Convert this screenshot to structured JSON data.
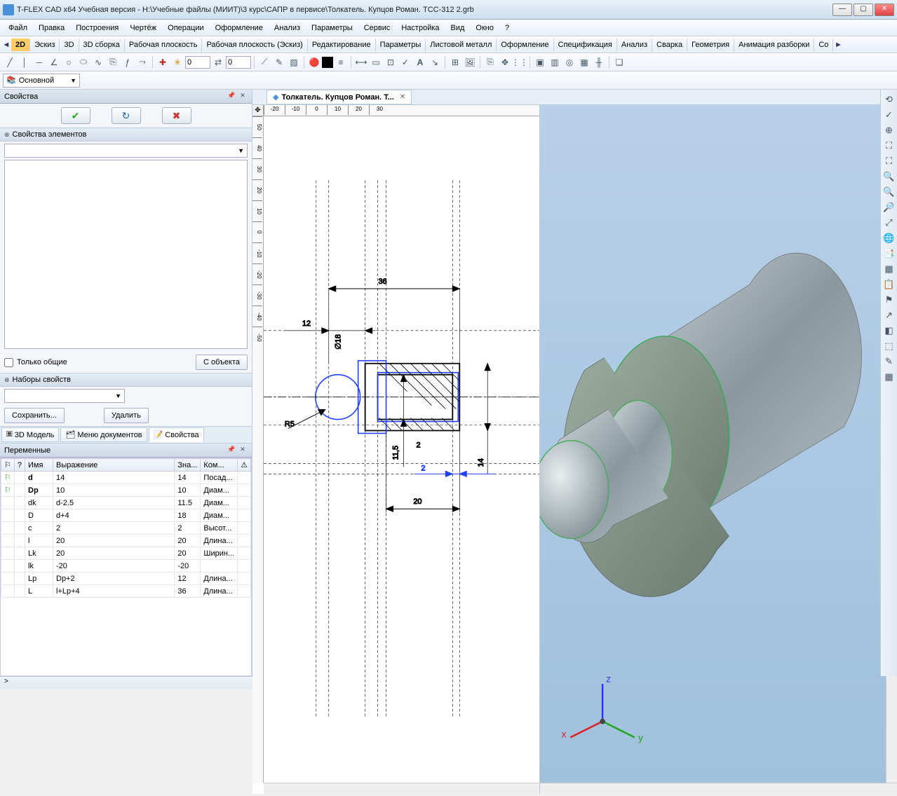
{
  "title": "T-FLEX CAD x64 Учебная версия - H:\\Учебные файлы (МИИТ)\\3 курс\\САПР в первисе\\Толкатель. Купцов Роман. ТСС-312 2.grb",
  "menu": [
    "Файл",
    "Правка",
    "Построения",
    "Чертёж",
    "Операции",
    "Оформление",
    "Анализ",
    "Параметры",
    "Сервис",
    "Настройка",
    "Вид",
    "Окно",
    "?"
  ],
  "modetabs": [
    "2D",
    "Эскиз",
    "3D",
    "3D сборка",
    "Рабочая плоскость",
    "Рабочая плоскость (Эскиз)",
    "Редактирование",
    "Параметры",
    "Листовой металл",
    "Оформление",
    "Спецификация",
    "Анализ",
    "Сварка",
    "Геометрия",
    "Анимация разборки",
    "Со"
  ],
  "active_modetab": "2D",
  "layer_label": "Основной",
  "num1": "0",
  "num2": "0",
  "properties": {
    "title": "Свойства",
    "section1": "Свойства элементов",
    "only_common": "Только общие",
    "from_object": "С объекта",
    "section2": "Наборы свойств",
    "save_btn": "Сохранить...",
    "delete_btn": "Удалить"
  },
  "bottom_tabs": {
    "m3d": "3D Модель",
    "docmenu": "Меню документов",
    "props": "Свойства"
  },
  "vars": {
    "title": "Переменные",
    "cols": {
      "q": "?",
      "name": "Имя",
      "expr": "Выражение",
      "val": "Зна...",
      "com": "Ком..."
    },
    "rows": [
      {
        "flag": 1,
        "name": "d",
        "expr": "14",
        "val": "14",
        "com": "Посад...",
        "bold": true
      },
      {
        "flag": 1,
        "name": "Dp",
        "expr": "10",
        "val": "10",
        "com": "Диам...",
        "bold": true
      },
      {
        "flag": 0,
        "name": "dk",
        "expr": "d-2.5",
        "val": "11.5",
        "com": "Диам..."
      },
      {
        "flag": 0,
        "name": "D",
        "expr": "d+4",
        "val": "18",
        "com": "Диам..."
      },
      {
        "flag": 0,
        "name": "c",
        "expr": "2",
        "val": "2",
        "com": "Высот..."
      },
      {
        "flag": 0,
        "name": "l",
        "expr": "20",
        "val": "20",
        "com": "Длина..."
      },
      {
        "flag": 0,
        "name": "Lk",
        "expr": "20",
        "val": "20",
        "com": "Ширин..."
      },
      {
        "flag": 0,
        "name": "lk",
        "expr": "-20",
        "val": "-20",
        "com": ""
      },
      {
        "flag": 0,
        "name": "Lp",
        "expr": "Dp+2",
        "val": "12",
        "com": "Длина..."
      },
      {
        "flag": 0,
        "name": "L",
        "expr": "l+Lp+4",
        "val": "36",
        "com": "Длина..."
      }
    ]
  },
  "doc_tab": "Толкатель. Купцов Роман. Т...",
  "drawing": {
    "dims": {
      "d36": "36",
      "d12": "12",
      "phi18": "∅18",
      "r5": "R5",
      "d115": "11,5",
      "d2": "2",
      "d20": "20",
      "d14": "14",
      "d2b": "2"
    },
    "ruler_h": [
      "-20",
      "-10",
      "0",
      "10",
      "20",
      "30"
    ],
    "ruler_v": [
      "50",
      "40",
      "30",
      "20",
      "10",
      "0",
      "-10",
      "-20",
      "-30",
      "-40",
      "-50"
    ]
  },
  "axis3d": {
    "x": "x",
    "y": "y",
    "z": "z"
  },
  "righttool_icons": [
    "⟲",
    "✓",
    "⊕",
    "⛶",
    "⛶",
    "🔍",
    "🔍",
    "🔎",
    "⤢",
    "🌐",
    "📑",
    "▦",
    "📋",
    "⚑",
    "↗",
    "◧",
    "⬚",
    "✎",
    "▦"
  ]
}
